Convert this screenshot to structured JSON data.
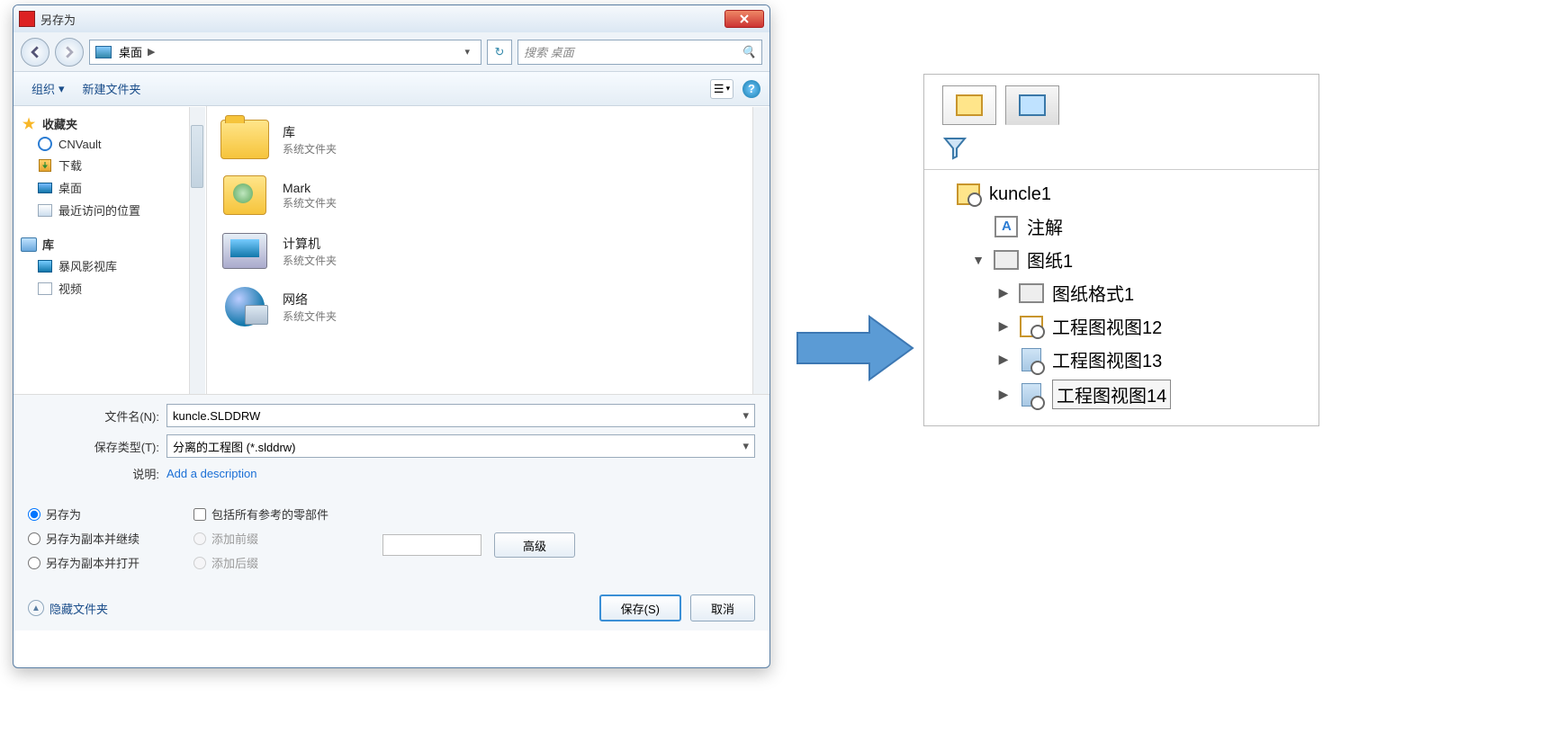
{
  "dialog": {
    "title": "另存为",
    "breadcrumb": "桌面",
    "search_placeholder": "搜索 桌面",
    "toolbar": {
      "organize": "组织",
      "new_folder": "新建文件夹"
    },
    "sidebar": {
      "favorites_label": "收藏夹",
      "favorites": [
        {
          "label": "CNVault"
        },
        {
          "label": "下载"
        },
        {
          "label": "桌面"
        },
        {
          "label": "最近访问的位置"
        }
      ],
      "libraries_label": "库",
      "libraries": [
        {
          "label": "暴风影视库"
        },
        {
          "label": "视频"
        }
      ]
    },
    "main_items": [
      {
        "title": "库",
        "sub": "系统文件夹"
      },
      {
        "title": "Mark",
        "sub": "系统文件夹"
      },
      {
        "title": "计算机",
        "sub": "系统文件夹"
      },
      {
        "title": "网络",
        "sub": "系统文件夹"
      }
    ],
    "filename_label": "文件名(N):",
    "filename_value": "kuncle.SLDDRW",
    "filetype_label": "保存类型(T):",
    "filetype_value": "分离的工程图 (*.slddrw)",
    "desc_label": "说明:",
    "desc_link": "Add a description",
    "radios": {
      "save_as": "另存为",
      "save_copy_continue": "另存为副本并继续",
      "save_copy_open": "另存为副本并打开"
    },
    "checks": {
      "include_refs": "包括所有参考的零部件",
      "add_prefix": "添加前缀",
      "add_suffix": "添加后缀"
    },
    "advanced": "高级",
    "hide_folders": "隐藏文件夹",
    "save_btn": "保存(S)",
    "cancel_btn": "取消"
  },
  "tree": {
    "root": "kuncle1",
    "annotations": "注解",
    "sheet": "图纸1",
    "sheet_format": "图纸格式1",
    "views": [
      "工程图视图12",
      "工程图视图13",
      "工程图视图14"
    ]
  }
}
